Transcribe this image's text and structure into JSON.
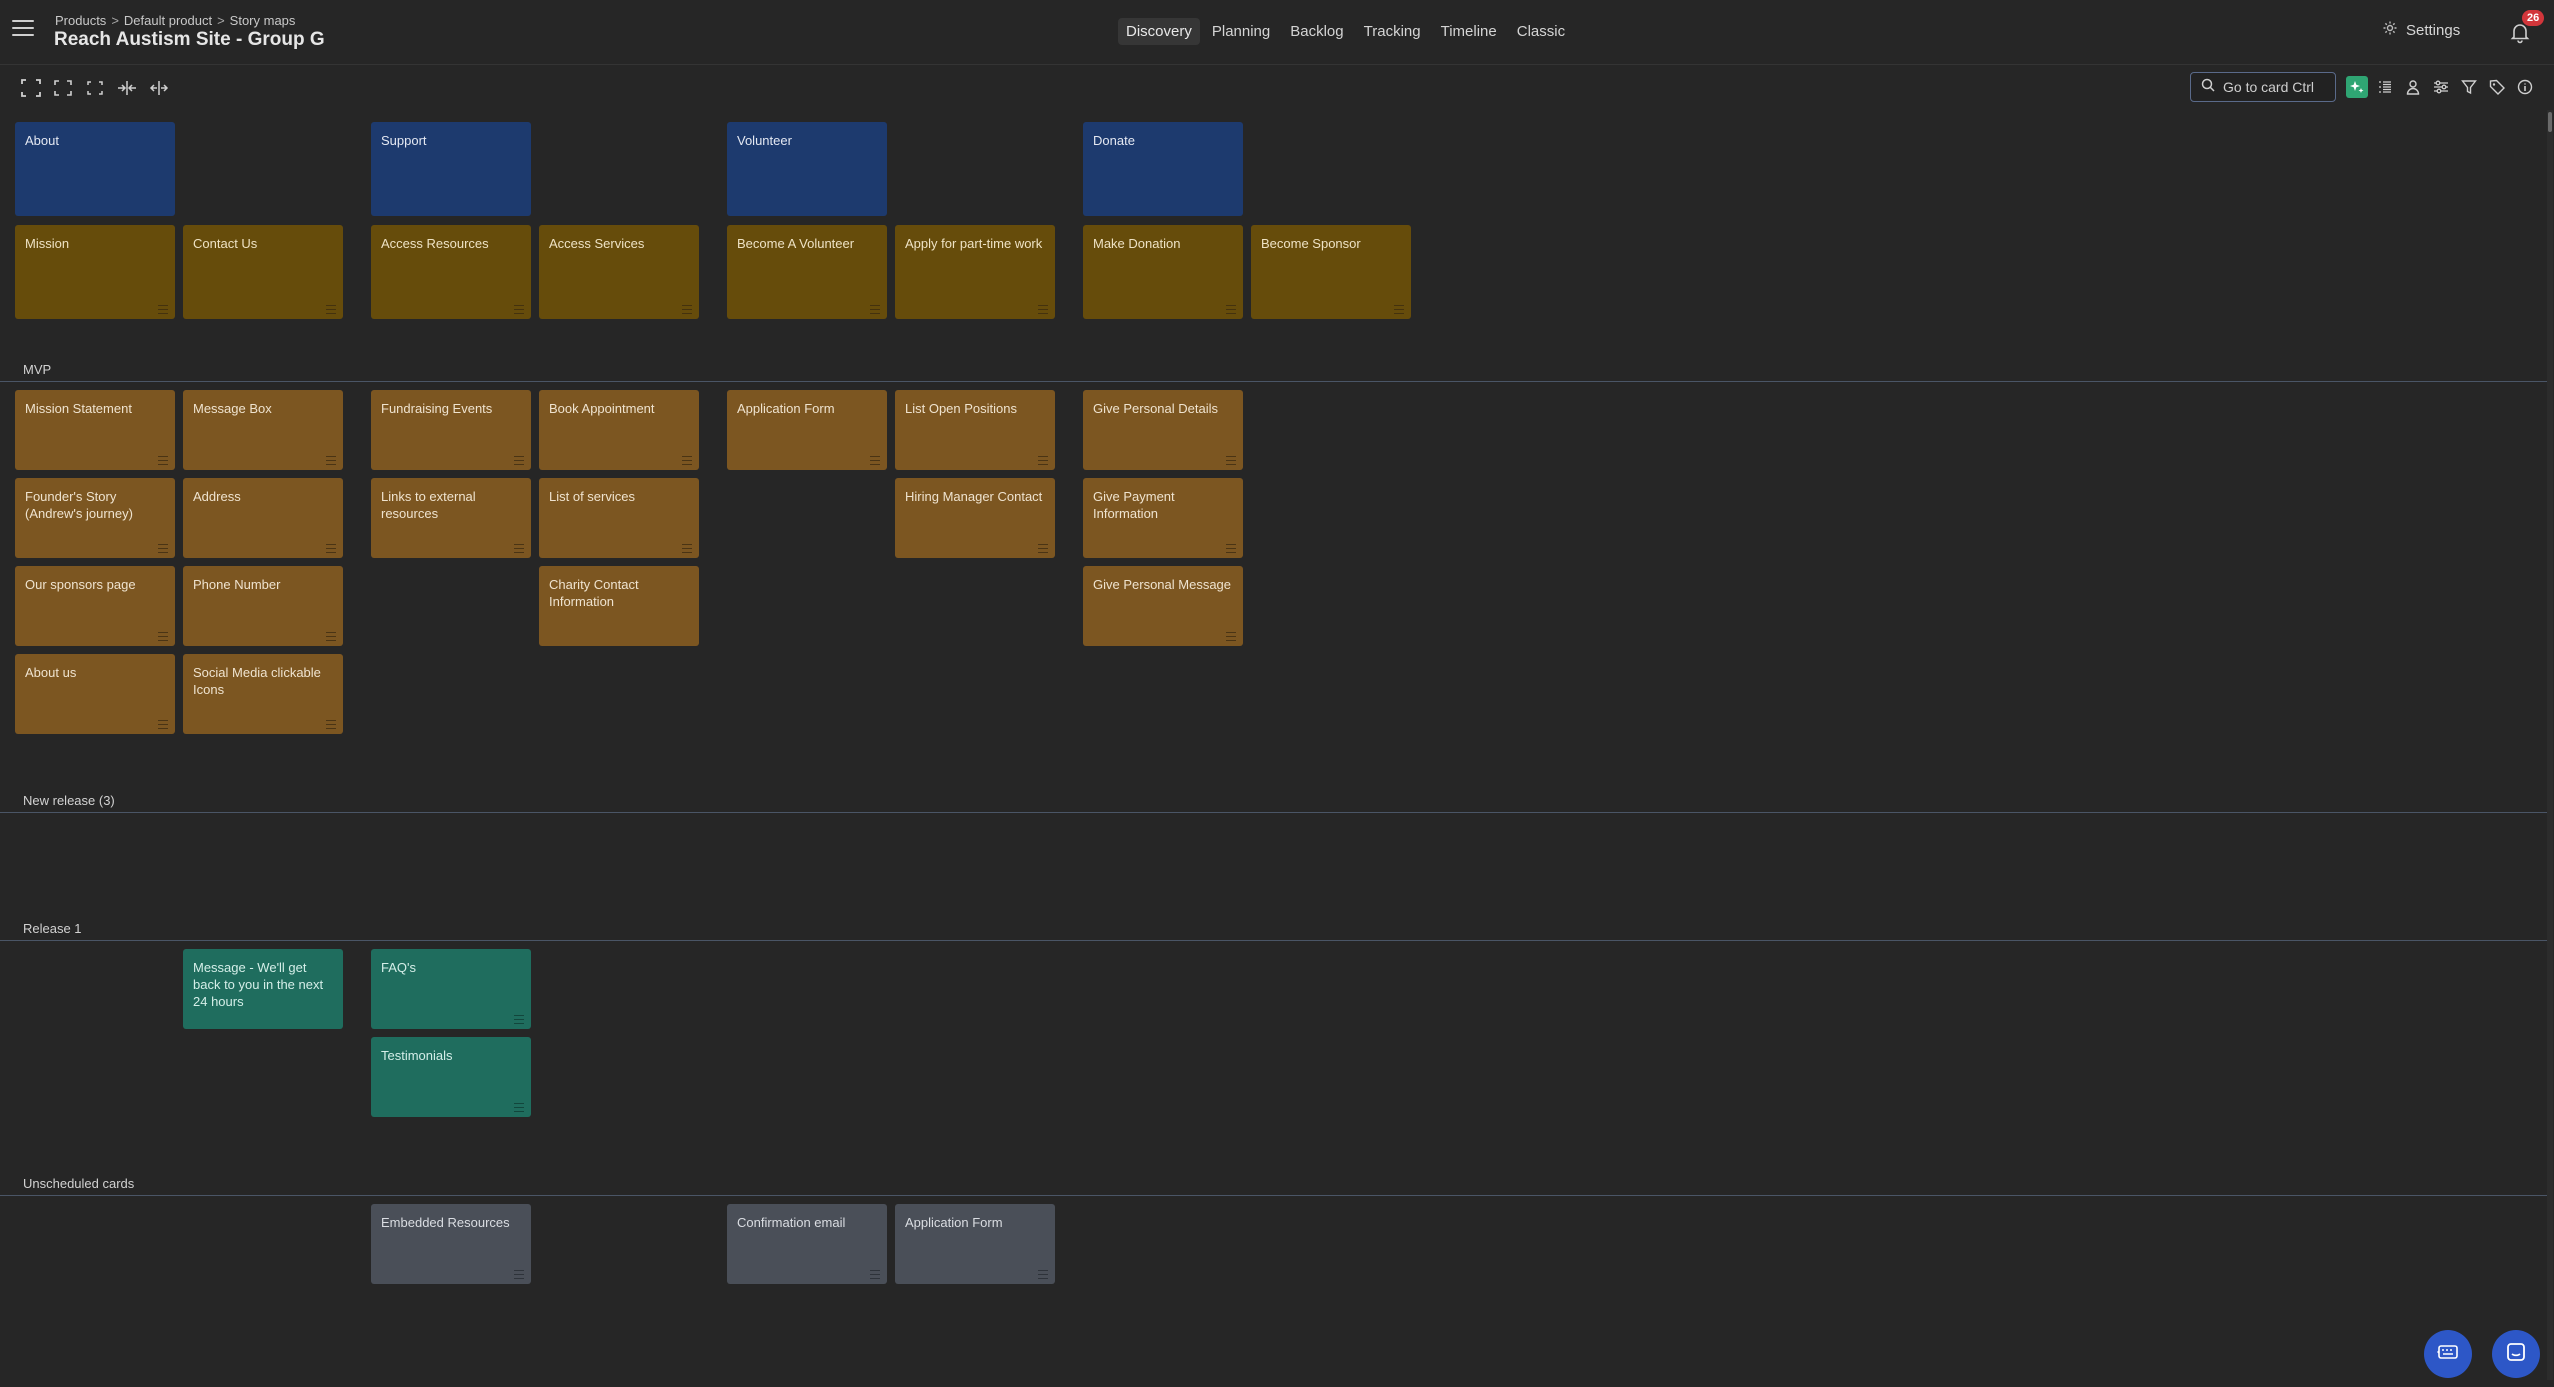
{
  "header": {
    "breadcrumb": [
      "Products",
      "Default product",
      "Story maps"
    ],
    "breadcrumb_sep": ">",
    "title": "Reach Austism Site - Group G",
    "tabs": [
      "Discovery",
      "Planning",
      "Backlog",
      "Tracking",
      "Timeline",
      "Classic"
    ],
    "active_tab": "Discovery",
    "settings_label": "Settings",
    "notification_count": "26"
  },
  "toolbar": {
    "left_icons": [
      "expand-all-icon",
      "expand-icon",
      "collapse-icon",
      "narrow-columns-icon",
      "widen-columns-icon"
    ],
    "search_placeholder": "Go to card Ctrl",
    "right_icons": [
      "ai-assistant-icon",
      "list-view-icon",
      "person-icon",
      "settings-sliders-icon",
      "filter-icon",
      "tag-icon",
      "info-icon"
    ]
  },
  "activities": [
    "About",
    "Support",
    "Volunteer",
    "Donate"
  ],
  "tasks": [
    "Mission",
    "Contact Us",
    "Access Resources",
    "Access Services",
    "Become A Volunteer",
    "Apply for part-time work",
    "Make Donation",
    "Become Sponsor"
  ],
  "releases": {
    "mvp": {
      "label": "MVP",
      "cards": [
        "Mission Statement",
        "Founder's Story (Andrew's journey)",
        "Our sponsors page",
        "About us",
        "Message Box",
        "Address",
        "Phone Number",
        "Social Media clickable Icons",
        "Fundraising Events",
        "Links to external resources",
        "Book Appointment",
        "List of services",
        "Charity Contact Information",
        "Application Form",
        "List Open Positions",
        "Hiring Manager Contact",
        "Give Personal Details",
        "Give Payment Information",
        "Give Personal Message"
      ]
    },
    "new_release": {
      "label": "New release (3)"
    },
    "release1": {
      "label": "Release 1",
      "cards": [
        "Message - We'll get back to you in the next 24 hours",
        "FAQ's",
        "Testimonials"
      ]
    },
    "unscheduled": {
      "label": "Unscheduled cards",
      "cards": [
        "Embedded Resources",
        "Confirmation email",
        "Application Form"
      ]
    }
  },
  "colors": {
    "activity": "#1d3a6e",
    "task": "#664c0b",
    "story": "#7c5621",
    "release1": "#1f6d5e",
    "unscheduled": "#4a4f58",
    "accent_ai": "#2fa573",
    "badge": "#d2363b",
    "fab": "#2d57c7"
  }
}
